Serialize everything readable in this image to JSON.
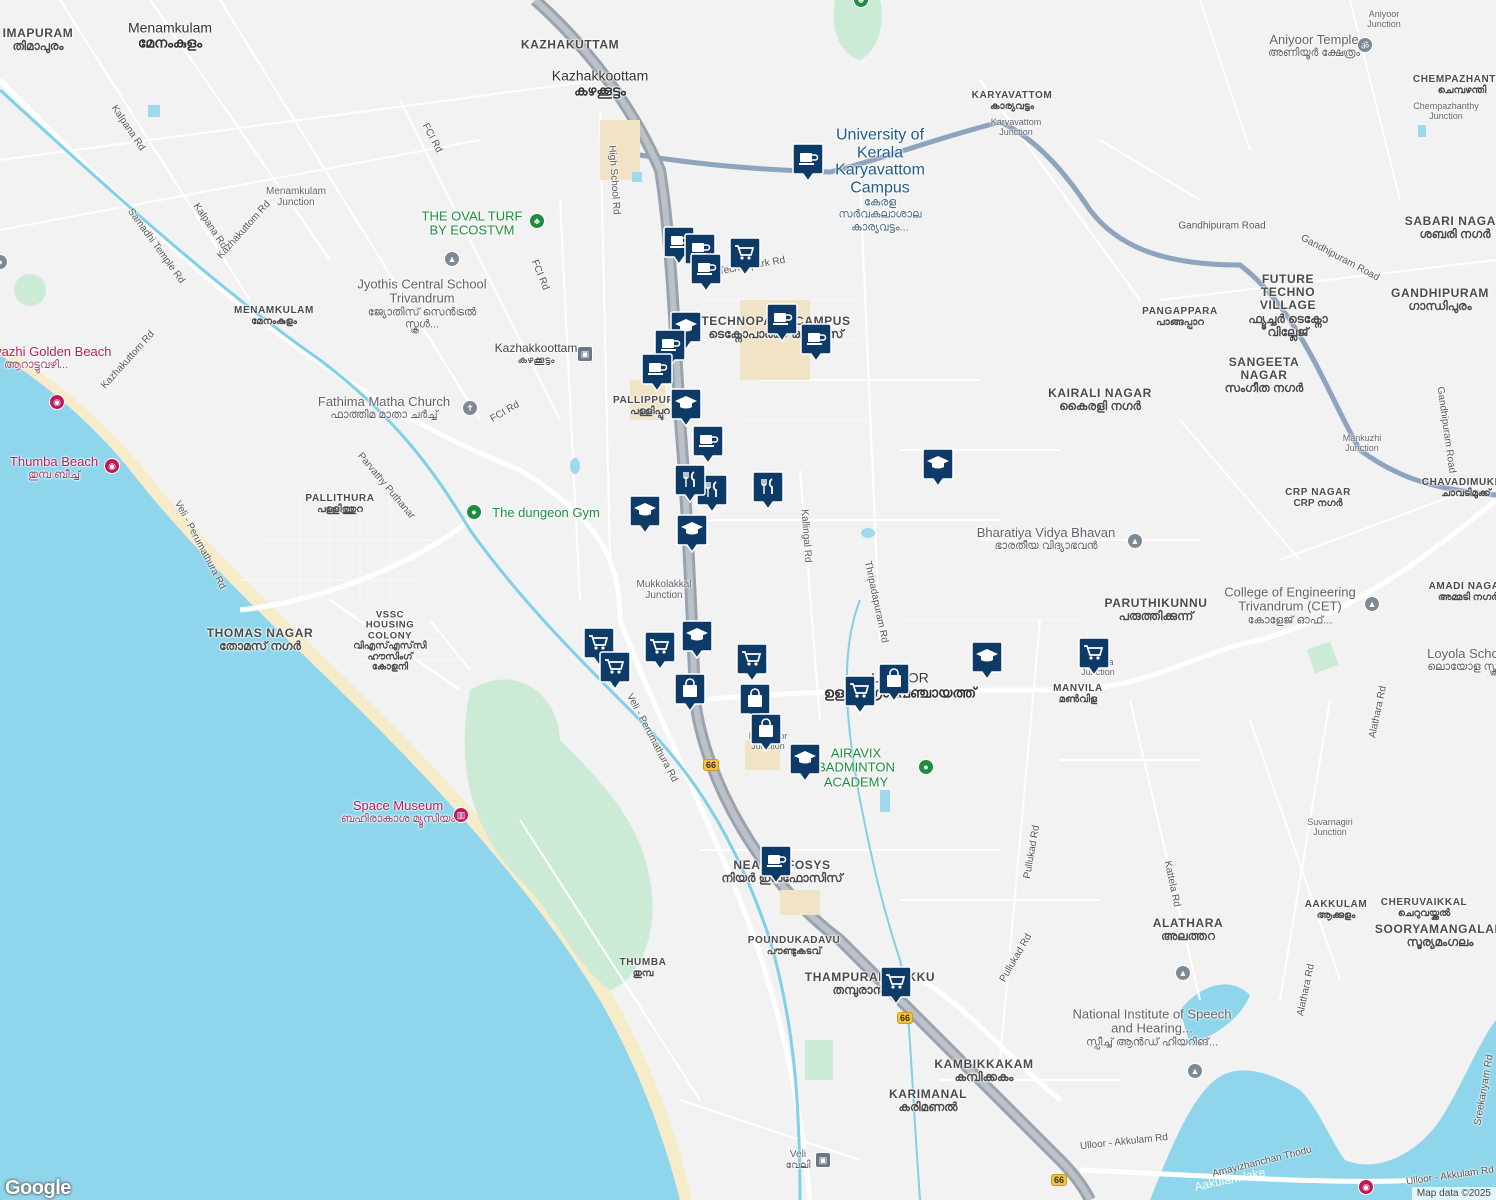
{
  "map": {
    "attribution": "Map data ©2025",
    "logo": "Google",
    "colors": {
      "land": "#f2f2f2",
      "sea": "#8fd6ec",
      "park": "#ccebd6",
      "road": "#ffffff",
      "highway": "#9aa3ad",
      "marker": "#0d3a66",
      "water_line": "#7fd0e8"
    }
  },
  "areas": [
    {
      "en": "KAZHAKUTTAM",
      "ml": ""
    },
    {
      "en": "Kazhakkoottam",
      "ml": "കഴക്കൂട്ടം"
    },
    {
      "en": "Menamkulam",
      "ml": "മേനംകുളം"
    },
    {
      "en": "IMAPURAM",
      "ml": "തിമാപുരം"
    },
    {
      "en": "MENAMKULAM",
      "ml": "മേനംകുളം"
    },
    {
      "en": "PALLITHURA",
      "ml": "പള്ളിത്തുറ"
    },
    {
      "en": "THOMAS NAGAR",
      "ml": "തോമസ് നഗർ"
    },
    {
      "en": "VSSC HOUSING COLONY",
      "ml": "വിഎസ്എസ്‌സി ഹൗസിംഗ് കോളനി"
    },
    {
      "en": "TECHNOPARK CAMPUS",
      "ml": "ടെക്നോപാർക്ക് ക്യാമ്പസ്"
    },
    {
      "en": "PALLIPPURAM",
      "ml": "പള്ളിപ്പുറം"
    },
    {
      "en": "KARYAVATTOM",
      "ml": "കാര്യവട്ടം"
    },
    {
      "en": "PANGAPPARA",
      "ml": "പാങ്ങപ്പാറ"
    },
    {
      "en": "KAIRALI NAGAR",
      "ml": "കൈരളി നഗർ"
    },
    {
      "en": "FUTURE TECHNO VILLAGE",
      "ml": "ഫ്യൂച്ചർ ടെക്നോ വില്ലേജ്"
    },
    {
      "en": "SANGEETA NAGAR",
      "ml": "സംഗീത നഗർ"
    },
    {
      "en": "GANDHIPURAM",
      "ml": "ഗാന്ധിപുരം"
    },
    {
      "en": "SABARI NAGAR",
      "ml": "ശബരി നഗർ"
    },
    {
      "en": "CHEMPAZHANTHY",
      "ml": "ചെമ്പഴന്തി"
    },
    {
      "en": "CRP NAGAR",
      "ml": "CRP നഗർ"
    },
    {
      "en": "CHAVADIMUKKU",
      "ml": "ചാവടിമുക്ക്"
    },
    {
      "en": "PARUTHIKUNNU",
      "ml": "പരുത്തിക്കുന്ന്"
    },
    {
      "en": "AMADI NAGAR",
      "ml": "അമ്മടി നഗർ"
    },
    {
      "en": "ULLOOR",
      "ml": "ഉള്ളൂർ ഗ്രാമപഞ്ചായത്ത്"
    },
    {
      "en": "MANVILA",
      "ml": "മൺവിള"
    },
    {
      "en": "NEAR INFOSYS",
      "ml": "നിയർ ഇൻഫോസിസ്"
    },
    {
      "en": "POUNDUKADAVU",
      "ml": "പൗണ്ടുകടവ്"
    },
    {
      "en": "THAMPURANMUKKU",
      "ml": "തമ്പുരാൻമുക്ക്"
    },
    {
      "en": "THUMBA",
      "ml": "തുമ്പ"
    },
    {
      "en": "ALATHARA",
      "ml": "അലത്തറ"
    },
    {
      "en": "AAKKULAM",
      "ml": "ആക്കുളം"
    },
    {
      "en": "CHERUVAIKKAL",
      "ml": "ചെറുവയ്ക്കൽ"
    },
    {
      "en": "SOORYAMANGALAM",
      "ml": "സൂര്യമംഗലം"
    },
    {
      "en": "KAMBIKKAKAM",
      "ml": "കമ്പിക്കകം"
    },
    {
      "en": "KARIMANAL",
      "ml": "കരിമണൽ"
    },
    {
      "en": "Veli",
      "ml": "വേലി"
    }
  ],
  "places": [
    {
      "en": "University of Kerala Karyavattom Campus",
      "ml": "കേരള സർവകലാശാല കാര്യവട്ടം...",
      "kind": "blue"
    },
    {
      "en": "THE OVAL TURF BY ECOSTVM",
      "ml": "",
      "kind": "green"
    },
    {
      "en": "Jyothis Central School Trivandrum",
      "ml": "ജ്യോതിസ് സെൻട്രൽ സ്കൂൾ...",
      "kind": "grey"
    },
    {
      "en": "Fathima Matha Church",
      "ml": "ഫാത്തിമ മാതാ ചർച്ച്",
      "kind": "grey"
    },
    {
      "en": "The dungeon Gym",
      "ml": "",
      "kind": "green"
    },
    {
      "en": "Thumba Beach",
      "ml": "തുമ്പ ബീച്ച്",
      "kind": "pink"
    },
    {
      "en": "Arattuvazhi Golden Beach",
      "ml": "ആറാട്ടുവഴി...",
      "kind": "pink"
    },
    {
      "en": "Space Museum",
      "ml": "ബഹിരാകാശ മ്യൂസിയം",
      "kind": "pink"
    },
    {
      "en": "Aniyoor Temple",
      "ml": "അണിയൂർ ക്ഷേത്രം",
      "kind": "grey"
    },
    {
      "en": "Bharatiya Vidya Bhavan",
      "ml": "ഭാരതീയ വിദ്യാഭവൻ",
      "kind": "grey"
    },
    {
      "en": "College of Engineering Trivandrum (CET)",
      "ml": "കോളേജ് ഓഫ്...",
      "kind": "grey"
    },
    {
      "en": "AIRAVIX BADMINTON ACADEMY",
      "ml": "",
      "kind": "green"
    },
    {
      "en": "National Institute of Speech and Hearing...",
      "ml": "സ്പീച്ച് ആൻഡ് ഹിയറിങ്...",
      "kind": "grey"
    },
    {
      "en": "Loyola School",
      "ml": "ലൊയോള സ്കൂൾ",
      "kind": "grey"
    },
    {
      "en": "Aakulam lake",
      "ml": "",
      "kind": "lake"
    }
  ],
  "small_labels": [
    "Menamkulam Junction",
    "Kazhakkoottam",
    "കഴക്കൂട്ടം",
    "Karyavattom Junction",
    "Mankuzhi Junction",
    "Chempazhanthy Junction",
    "Mukkolakkal Junction",
    "Kulathoor Junction",
    "Manvila Junction",
    "Suvarnagiri Junction",
    "Aniyoor Junction"
  ],
  "roads": [
    "FCI Rd",
    "Kalpana Rd",
    "Samadhi Temple Rd",
    "Kazhakuttom Rd",
    "High School Rd",
    "Technopark Rd",
    "Gandhipuram Road",
    "Kallingal Rd",
    "Thripadapuram Rd",
    "Veli - Perumathura Rd",
    "Parvathy Puthanar",
    "Pullukad Rd",
    "Kattela Rd",
    "Alathara Rd",
    "Ulloor - Akkulam Rd",
    "Amayizhanchan Thodu",
    "Sreekariyam Rd"
  ],
  "highway_shield": "66",
  "markers": [
    {
      "type": "cafe"
    },
    {
      "type": "cafe"
    },
    {
      "type": "cafe"
    },
    {
      "type": "cafe"
    },
    {
      "type": "shopping-cart"
    },
    {
      "type": "cafe"
    },
    {
      "type": "cafe"
    },
    {
      "type": "school"
    },
    {
      "type": "cafe"
    },
    {
      "type": "cafe"
    },
    {
      "type": "school"
    },
    {
      "type": "cafe"
    },
    {
      "type": "restaurant"
    },
    {
      "type": "restaurant"
    },
    {
      "type": "restaurant"
    },
    {
      "type": "school"
    },
    {
      "type": "school"
    },
    {
      "type": "school"
    },
    {
      "type": "shopping-cart"
    },
    {
      "type": "shopping-cart"
    },
    {
      "type": "shopping-cart"
    },
    {
      "type": "school"
    },
    {
      "type": "shopping-bag"
    },
    {
      "type": "shopping-cart"
    },
    {
      "type": "shopping-bag"
    },
    {
      "type": "shopping-bag"
    },
    {
      "type": "school"
    },
    {
      "type": "cafe"
    },
    {
      "type": "shopping-cart"
    },
    {
      "type": "shopping-bag"
    },
    {
      "type": "school"
    },
    {
      "type": "shopping-cart"
    },
    {
      "type": "shopping-cart"
    }
  ]
}
